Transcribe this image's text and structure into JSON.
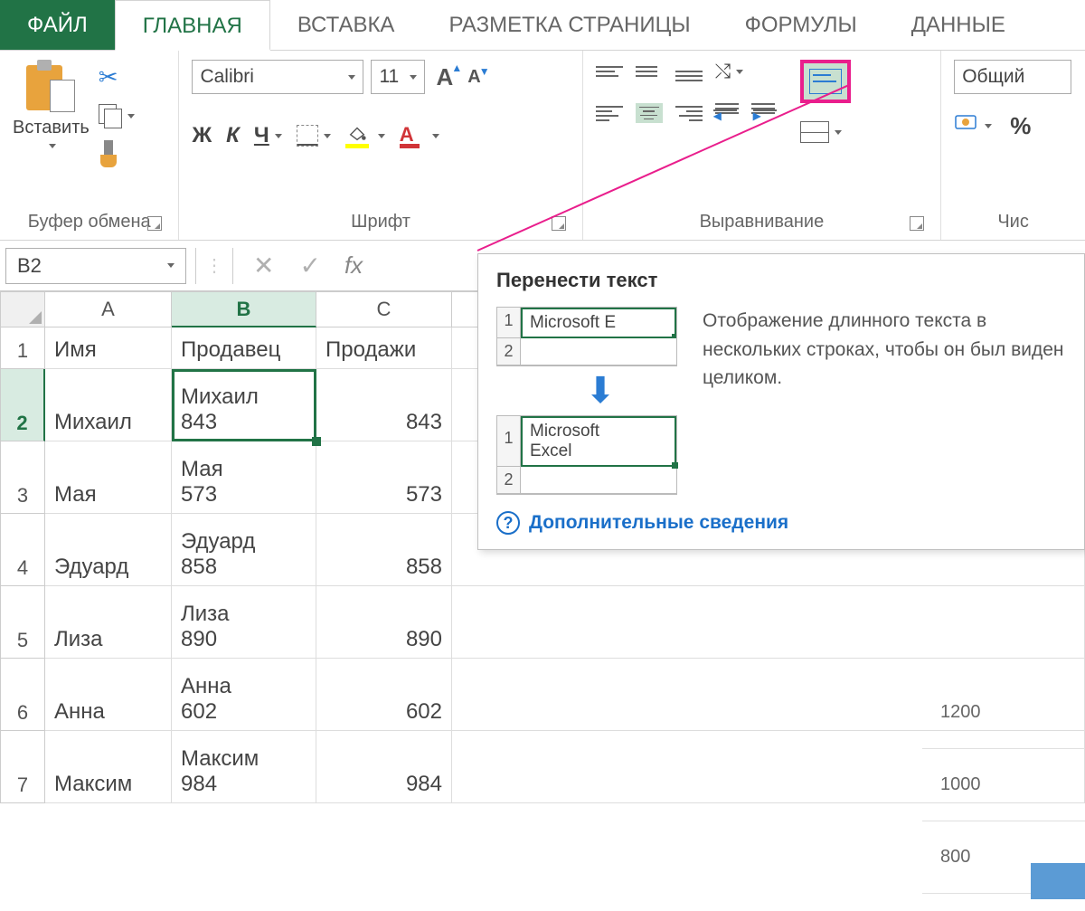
{
  "tabs": {
    "file": "ФАЙЛ",
    "home": "ГЛАВНАЯ",
    "insert": "ВСТАВКА",
    "layout": "РАЗМЕТКА СТРАНИЦЫ",
    "formulas": "ФОРМУЛЫ",
    "data": "ДАННЫЕ"
  },
  "ribbon": {
    "clipboard": {
      "paste": "Вставить",
      "label": "Буфер обмена"
    },
    "font": {
      "name": "Calibri",
      "size": "11",
      "bold": "Ж",
      "italic": "К",
      "underline": "Ч",
      "colorA": "А",
      "label": "Шрифт"
    },
    "align": {
      "label": "Выравнивание"
    },
    "number": {
      "format": "Общий",
      "pct": "%",
      "label": "Чис"
    }
  },
  "formula_bar": {
    "cell_ref": "B2",
    "fx": "fx"
  },
  "columns": [
    "A",
    "B",
    "C"
  ],
  "headers": {
    "A": "Имя",
    "B": "Продавец",
    "C": "Продажи"
  },
  "rows": [
    {
      "n": "1"
    },
    {
      "n": "2",
      "A": "Михаил",
      "B1": "Михаил",
      "B2": "843",
      "C": "843"
    },
    {
      "n": "3",
      "A": "Мая",
      "B1": "Мая",
      "B2": "573",
      "C": "573"
    },
    {
      "n": "4",
      "A": "Эдуард",
      "B1": "Эдуард",
      "B2": "858",
      "C": "858"
    },
    {
      "n": "5",
      "A": "Лиза",
      "B1": "Лиза",
      "B2": "890",
      "C": "890"
    },
    {
      "n": "6",
      "A": "Анна",
      "B1": "Анна",
      "B2": "602",
      "C": "602"
    },
    {
      "n": "7",
      "A": "Максим",
      "B1": "Максим",
      "B2": "984",
      "C": "984"
    }
  ],
  "tooltip": {
    "title": "Перенести текст",
    "desc": "Отображение длинного текста в нескольких строках, чтобы он был виден целиком.",
    "more": "Дополнительные сведения",
    "demo_before": "Microsoft E",
    "demo_after1": "Microsoft",
    "demo_after2": "Excel",
    "r1": "1",
    "r2": "2"
  },
  "chart": {
    "ticks": [
      "1200",
      "1000",
      "800"
    ]
  }
}
